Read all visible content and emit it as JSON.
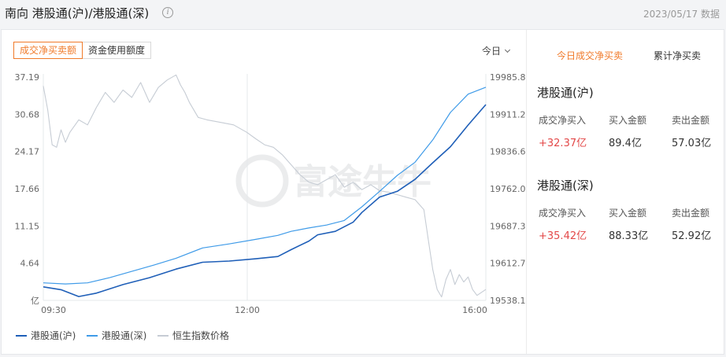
{
  "header": {
    "title": "南向 港股通(沪)/港股通(深)",
    "info_icon": "info-icon",
    "date": "2023/05/17 数据"
  },
  "left_tabs": [
    "成交净买卖额",
    "资金使用额度"
  ],
  "period_selector": "今日",
  "right_tabs": [
    "今日成交净买卖",
    "累计净买卖"
  ],
  "colors": {
    "accent": "#f07a2a",
    "hgt_sh": "#1f5fb8",
    "hgt_sz": "#3f9be8",
    "hsi": "#c6ccd4",
    "up": "#e34848"
  },
  "chart_data": {
    "type": "line",
    "title": "",
    "watermark": "富途牛牛",
    "x_ticks": [
      "09:30",
      "12:00",
      "16:00"
    ],
    "y_left": {
      "unit": "亿",
      "ticks": [
        37.19,
        30.68,
        24.17,
        17.66,
        11.15,
        4.64
      ],
      "range": [
        -1.87,
        37.19
      ]
    },
    "y_right": {
      "ticks": [
        19985.8,
        19911.2,
        19836.6,
        19762.0,
        19687.3,
        19612.7,
        19538.1
      ],
      "range": [
        19538.1,
        19985.8
      ]
    },
    "series": [
      {
        "name": "港股通(沪)",
        "axis": "left",
        "points": [
          [
            0,
            0.5
          ],
          [
            0.04,
            0.0
          ],
          [
            0.08,
            -1.2
          ],
          [
            0.12,
            -0.6
          ],
          [
            0.18,
            0.9
          ],
          [
            0.24,
            2.1
          ],
          [
            0.3,
            3.6
          ],
          [
            0.36,
            4.8
          ],
          [
            0.42,
            5.0
          ],
          [
            0.48,
            5.4
          ],
          [
            0.53,
            5.8
          ],
          [
            0.56,
            7.0
          ],
          [
            0.6,
            8.5
          ],
          [
            0.62,
            9.6
          ],
          [
            0.66,
            10.2
          ],
          [
            0.7,
            11.8
          ],
          [
            0.72,
            13.5
          ],
          [
            0.76,
            16.2
          ],
          [
            0.8,
            17.2
          ],
          [
            0.84,
            19.3
          ],
          [
            0.88,
            22.2
          ],
          [
            0.92,
            25.0
          ],
          [
            0.96,
            28.8
          ],
          [
            1.0,
            32.37
          ]
        ]
      },
      {
        "name": "港股通(深)",
        "axis": "left",
        "points": [
          [
            0,
            1.2
          ],
          [
            0.05,
            1.0
          ],
          [
            0.1,
            1.2
          ],
          [
            0.15,
            2.1
          ],
          [
            0.2,
            3.2
          ],
          [
            0.25,
            4.3
          ],
          [
            0.3,
            5.5
          ],
          [
            0.36,
            7.3
          ],
          [
            0.42,
            8.0
          ],
          [
            0.48,
            8.8
          ],
          [
            0.53,
            9.5
          ],
          [
            0.56,
            10.2
          ],
          [
            0.6,
            10.8
          ],
          [
            0.64,
            11.3
          ],
          [
            0.68,
            12.1
          ],
          [
            0.72,
            14.5
          ],
          [
            0.76,
            17.2
          ],
          [
            0.8,
            20.0
          ],
          [
            0.84,
            22.3
          ],
          [
            0.88,
            26.2
          ],
          [
            0.92,
            31.0
          ],
          [
            0.96,
            34.2
          ],
          [
            1.0,
            35.42
          ]
        ]
      },
      {
        "name": "恒生指数价格",
        "axis": "right",
        "points": [
          [
            0,
            19968
          ],
          [
            0.01,
            19920
          ],
          [
            0.02,
            19850
          ],
          [
            0.03,
            19845
          ],
          [
            0.04,
            19880
          ],
          [
            0.05,
            19855
          ],
          [
            0.06,
            19875
          ],
          [
            0.08,
            19900
          ],
          [
            0.1,
            19890
          ],
          [
            0.12,
            19925
          ],
          [
            0.14,
            19955
          ],
          [
            0.16,
            19935
          ],
          [
            0.18,
            19960
          ],
          [
            0.2,
            19945
          ],
          [
            0.22,
            19975
          ],
          [
            0.24,
            19935
          ],
          [
            0.26,
            19965
          ],
          [
            0.28,
            19980
          ],
          [
            0.3,
            19990
          ],
          [
            0.31,
            19970
          ],
          [
            0.32,
            19955
          ],
          [
            0.33,
            19935
          ],
          [
            0.35,
            19905
          ],
          [
            0.37,
            19900
          ],
          [
            0.4,
            19895
          ],
          [
            0.43,
            19890
          ],
          [
            0.46,
            19875
          ],
          [
            0.48,
            19862
          ],
          [
            0.5,
            19850
          ],
          [
            0.52,
            19845
          ],
          [
            0.54,
            19830
          ],
          [
            0.56,
            19810
          ],
          [
            0.58,
            19790
          ],
          [
            0.6,
            19775
          ],
          [
            0.62,
            19770
          ],
          [
            0.64,
            19780
          ],
          [
            0.66,
            19790
          ],
          [
            0.68,
            19765
          ],
          [
            0.7,
            19775
          ],
          [
            0.72,
            19760
          ],
          [
            0.74,
            19770
          ],
          [
            0.76,
            19758
          ],
          [
            0.78,
            19755
          ],
          [
            0.8,
            19750
          ],
          [
            0.82,
            19745
          ],
          [
            0.84,
            19740
          ],
          [
            0.86,
            19720
          ],
          [
            0.87,
            19660
          ],
          [
            0.88,
            19600
          ],
          [
            0.89,
            19560
          ],
          [
            0.9,
            19545
          ],
          [
            0.91,
            19580
          ],
          [
            0.92,
            19600
          ],
          [
            0.93,
            19570
          ],
          [
            0.94,
            19590
          ],
          [
            0.95,
            19575
          ],
          [
            0.96,
            19585
          ],
          [
            0.97,
            19560
          ],
          [
            0.98,
            19548
          ],
          [
            1.0,
            19560
          ]
        ]
      }
    ],
    "legend_position": "bottom"
  },
  "sh_block": {
    "title": "港股通(沪)",
    "labels": [
      "成交净买入",
      "买入金额",
      "卖出金额"
    ],
    "values": [
      "+32.37亿",
      "89.4亿",
      "57.03亿"
    ]
  },
  "sz_block": {
    "title": "港股通(深)",
    "labels": [
      "成交净买入",
      "买入金额",
      "卖出金额"
    ],
    "values": [
      "+35.42亿",
      "88.33亿",
      "52.92亿"
    ]
  }
}
